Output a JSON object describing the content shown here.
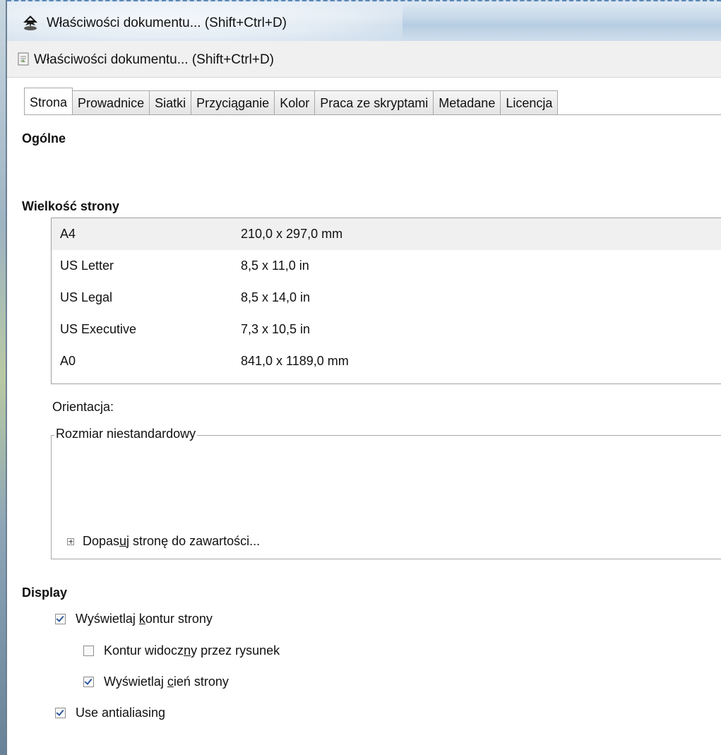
{
  "window": {
    "title": "Właściwości dokumentu... (Shift+Ctrl+D)",
    "icon": "inkscape-logo-icon"
  },
  "panel": {
    "title": "Właściwości dokumentu... (Shift+Ctrl+D)",
    "icon": "document-properties-icon"
  },
  "tabs": [
    {
      "label": "Strona",
      "active": true
    },
    {
      "label": "Prowadnice",
      "active": false
    },
    {
      "label": "Siatki",
      "active": false
    },
    {
      "label": "Przyciąganie",
      "active": false
    },
    {
      "label": "Kolor",
      "active": false
    },
    {
      "label": "Praca ze skryptami",
      "active": false
    },
    {
      "label": "Metadane",
      "active": false
    },
    {
      "label": "Licencja",
      "active": false
    }
  ],
  "general": {
    "heading": "Ogólne"
  },
  "page_size": {
    "heading": "Wielkość strony",
    "rows": [
      {
        "name": "A4",
        "size": "210,0 x 297,0 mm",
        "selected": true
      },
      {
        "name": "US Letter",
        "size": "8,5 x 11,0 in",
        "selected": false
      },
      {
        "name": "US Legal",
        "size": "8,5 x 14,0 in",
        "selected": false
      },
      {
        "name": "US Executive",
        "size": "7,3 x 10,5 in",
        "selected": false
      },
      {
        "name": "A0",
        "size": "841,0 x 1189,0 mm",
        "selected": false
      }
    ],
    "orientation_label": "Orientacja:",
    "custom_size_label": "Rozmiar niestandardowy",
    "fit_page": {
      "before": "Dopas",
      "mnemonic": "u",
      "after": "j stronę do zawartości..."
    }
  },
  "display": {
    "heading": "Display",
    "show_border": {
      "before": "Wyświetlaj ",
      "mnemonic": "k",
      "after": "ontur strony",
      "checked": true
    },
    "border_on_top": {
      "before": "Kontur widocz",
      "mnemonic": "n",
      "after": "y przez rysunek",
      "checked": false
    },
    "show_shadow": {
      "before": "Wyświetlaj ",
      "mnemonic": "c",
      "after": "ień strony",
      "checked": true
    },
    "antialiasing": {
      "label": "Use antialiasing",
      "checked": true
    }
  },
  "colors": {
    "tab_border": "#a7a7a7",
    "selected_row": "#f0f0f0",
    "check_mark": "#2c5a9c"
  }
}
